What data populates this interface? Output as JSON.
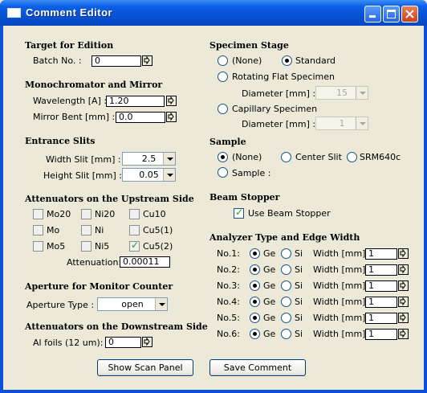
{
  "window": {
    "title": "Comment Editor",
    "icon": "window-icon"
  },
  "target": {
    "heading": "Target for Edition",
    "batch_label": "Batch No. :",
    "batch_value": "0"
  },
  "mono": {
    "heading": "Monochromator and Mirror",
    "wavelength_label": "Wavelength [A] :",
    "wavelength_value": "1.20",
    "mirror_label": "Mirror Bent [mm] :",
    "mirror_value": "0.0"
  },
  "slits": {
    "heading": "Entrance Slits",
    "width_label": "Width Slit [mm] :",
    "width_value": "2.5",
    "height_label": "Height Slit [mm] :",
    "height_value": "0.05"
  },
  "upstream": {
    "heading": "Attenuators on the Upstream Side",
    "items": [
      {
        "label": "Mo20",
        "checked": false
      },
      {
        "label": "Ni20",
        "checked": false
      },
      {
        "label": "Cu10",
        "checked": false
      },
      {
        "label": "Mo",
        "checked": false
      },
      {
        "label": "Ni",
        "checked": false
      },
      {
        "label": "Cu5(1)",
        "checked": false
      },
      {
        "label": "Mo5",
        "checked": false
      },
      {
        "label": "Ni5",
        "checked": false
      },
      {
        "label": "Cu5(2)",
        "checked": true
      }
    ],
    "attenuation_label": "Attenuation:",
    "attenuation_value": "0.00011"
  },
  "aperture": {
    "heading": "Aperture for Monitor Counter",
    "type_label": "Aperture Type :",
    "type_value": "open"
  },
  "downstream": {
    "heading": "Attenuators on the Downstream Side",
    "foils_label": "Al foils (12 um):",
    "foils_value": "0"
  },
  "stage": {
    "heading": "Specimen Stage",
    "none_label": "(None)",
    "standard_label": "Standard",
    "rotating_label": "Rotating Flat Specimen",
    "rot_diameter_label": "Diameter [mm] :",
    "rot_diameter_value": "15",
    "capillary_label": "Capillary Specimen",
    "cap_diameter_label": "Diameter [mm] :",
    "cap_diameter_value": "1",
    "selected": "Standard"
  },
  "sample": {
    "heading": "Sample",
    "none_label": "(None)",
    "center_label": "Center Slit",
    "srm_label": "SRM640c",
    "sample_label": "Sample :",
    "selected": "(None)"
  },
  "stopper": {
    "heading": "Beam Stopper",
    "use_label": "Use Beam Stopper",
    "checked": true
  },
  "analyzer": {
    "heading": "Analyzer Type and Edge Width",
    "ge_label": "Ge",
    "si_label": "Si",
    "width_label": "Width [mm]:",
    "rows": [
      {
        "label": "No.1:",
        "type": "Ge",
        "width": "1"
      },
      {
        "label": "No.2:",
        "type": "Ge",
        "width": "1"
      },
      {
        "label": "No.3:",
        "type": "Ge",
        "width": "1"
      },
      {
        "label": "No.4:",
        "type": "Ge",
        "width": "1"
      },
      {
        "label": "No.5:",
        "type": "Ge",
        "width": "1"
      },
      {
        "label": "No.6:",
        "type": "Ge",
        "width": "1"
      }
    ]
  },
  "buttons": {
    "scan_label": "Show Scan Panel",
    "save_label": "Save Comment"
  }
}
